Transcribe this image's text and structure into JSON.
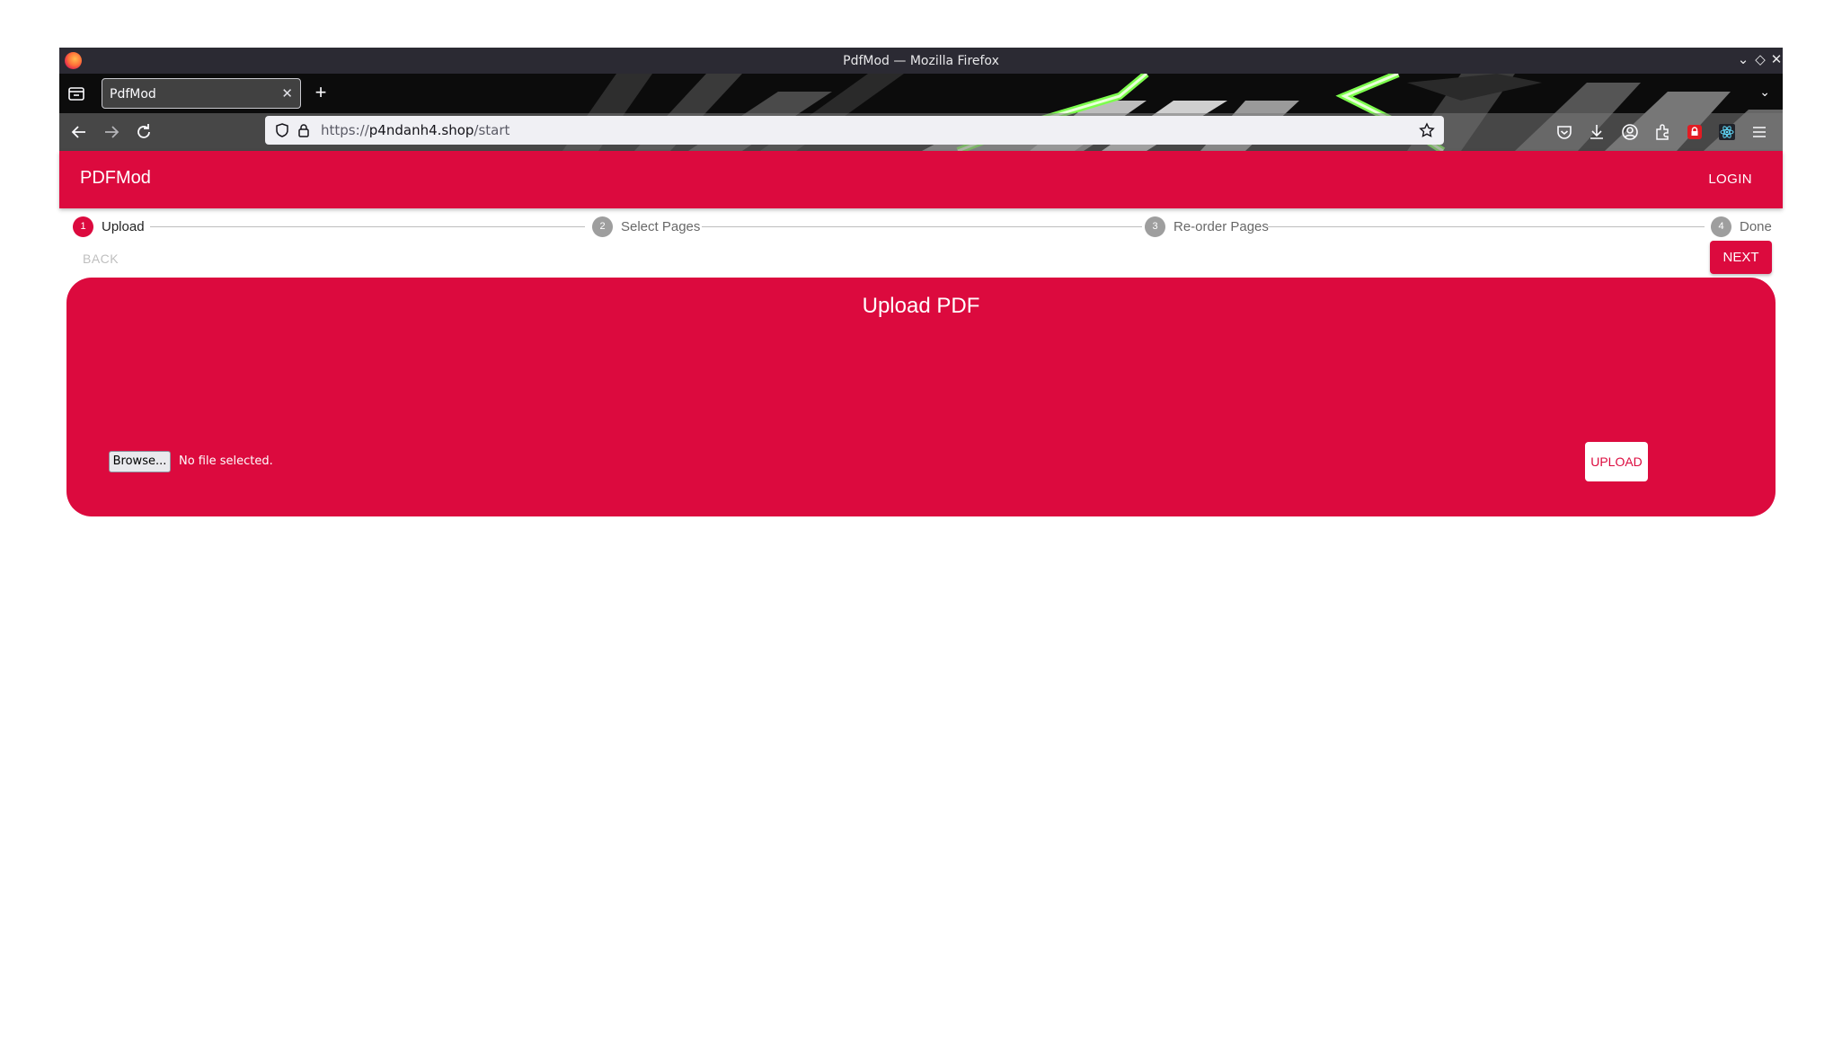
{
  "window": {
    "title": "PdfMod — Mozilla Firefox"
  },
  "browser": {
    "tab_title": "PdfMod",
    "url_prefix": "https://",
    "url_host": "p4ndanh4.shop",
    "url_path": "/start"
  },
  "app": {
    "brand": "PDFMod",
    "login_label": "LOGIN",
    "accent_color": "#dc0a3e"
  },
  "stepper": {
    "steps": [
      {
        "num": "1",
        "label": "Upload",
        "active": true
      },
      {
        "num": "2",
        "label": "Select Pages",
        "active": false
      },
      {
        "num": "3",
        "label": "Re-order Pages",
        "active": false
      },
      {
        "num": "4",
        "label": "Done",
        "active": false
      }
    ],
    "back_label": "BACK",
    "next_label": "NEXT"
  },
  "upload": {
    "title": "Upload PDF",
    "browse_label": "Browse...",
    "file_status": "No file selected.",
    "upload_label": "UPLOAD"
  }
}
